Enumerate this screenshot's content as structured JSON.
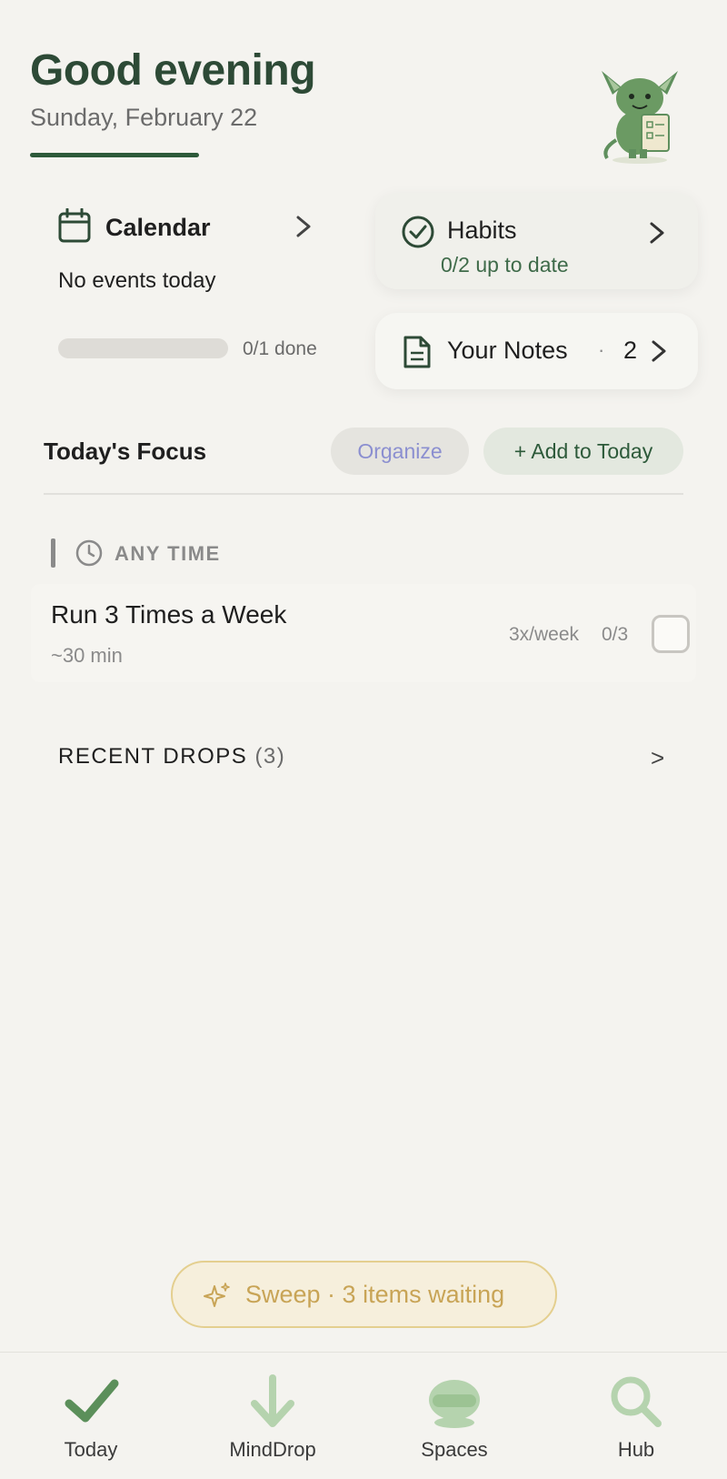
{
  "header": {
    "greeting": "Good evening",
    "date": "Sunday, February 22"
  },
  "calendar": {
    "title": "Calendar",
    "empty_text": "No events today",
    "progress_value": 0,
    "progress_text": "0/1 done"
  },
  "habits": {
    "title": "Habits",
    "subtitle": "0/2 up to date"
  },
  "notes": {
    "title": "Your Notes",
    "separator": "·",
    "count": "2"
  },
  "focus": {
    "title": "Today's Focus",
    "organize_label": "Organize",
    "add_label": "+ Add to Today"
  },
  "section": {
    "label": "ANY TIME"
  },
  "task": {
    "title": "Run 3 Times a Week",
    "duration": "~30 min",
    "frequency": "3x/week",
    "progress": "0/3",
    "checked": false
  },
  "recent": {
    "label": "RECENT DROPS",
    "count": "(3)",
    "chevron": ">"
  },
  "sweep": {
    "label": "Sweep · 3 items waiting"
  },
  "nav": {
    "items": [
      {
        "label": "Today",
        "icon": "checkmark-icon",
        "active": true
      },
      {
        "label": "MindDrop",
        "icon": "arrow-down-icon",
        "active": false
      },
      {
        "label": "Spaces",
        "icon": "helmet-icon",
        "active": false
      },
      {
        "label": "Hub",
        "icon": "search-icon",
        "active": false
      }
    ]
  },
  "colors": {
    "accent": "#2d4a36",
    "background": "#f4f3ef",
    "sweep": "#c8a456",
    "organize": "#8b8fd0"
  }
}
